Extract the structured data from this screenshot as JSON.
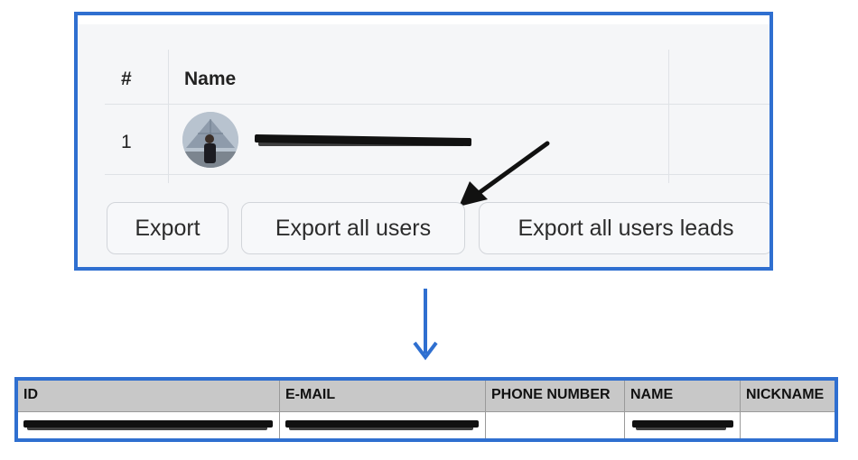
{
  "users_table": {
    "columns": [
      "#",
      "Name"
    ],
    "rows": [
      {
        "index": "1"
      }
    ]
  },
  "export_buttons": {
    "export_label": "Export",
    "export_all_users_label": "Export all users",
    "export_all_users_leads_label": "Export all users leads"
  },
  "export_sheet": {
    "headers": [
      "ID",
      "E-MAIL",
      "PHONE NUMBER",
      "NAME",
      "NICKNAME"
    ]
  },
  "colors": {
    "highlight_border": "#2f6fd0",
    "arrow": "#2f6fd0"
  },
  "icons": [
    "pointer-arrow-icon",
    "down-arrow-icon"
  ]
}
